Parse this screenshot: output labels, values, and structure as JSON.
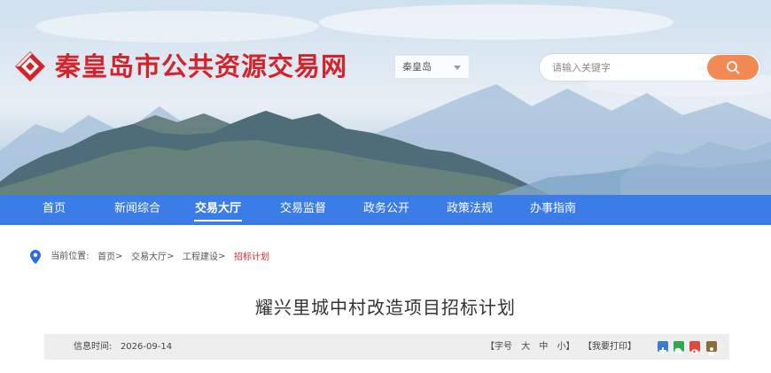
{
  "header": {
    "site_title": "秦皇岛市公共资源交易网",
    "region_select": {
      "value": "秦皇岛"
    },
    "search": {
      "placeholder": "请输入关键字"
    }
  },
  "nav": {
    "items": [
      {
        "label": "首页"
      },
      {
        "label": "新闻综合"
      },
      {
        "label": "交易大厅",
        "active": true
      },
      {
        "label": "交易监督"
      },
      {
        "label": "政务公开"
      },
      {
        "label": "政策法规"
      },
      {
        "label": "办事指南"
      }
    ]
  },
  "breadcrumb": {
    "prefix": "当前位置:",
    "items": [
      "首页",
      "交易大厅",
      "工程建设"
    ],
    "current": "招标计划",
    "separator": ">"
  },
  "article": {
    "title": "耀兴里城中村改造项目招标计划",
    "info_time_label": "信息时间:",
    "info_time_value": "2026-09-14",
    "font_size_label": "【字号",
    "font_large": "大",
    "font_medium": "中",
    "font_small": "小】",
    "print_label": "【我要打印】"
  },
  "colors": {
    "brand_red": "#d4232b",
    "nav_blue": "#3b7de6",
    "search_orange": "#f28a55",
    "breadcrumb_current": "#e0262c"
  }
}
